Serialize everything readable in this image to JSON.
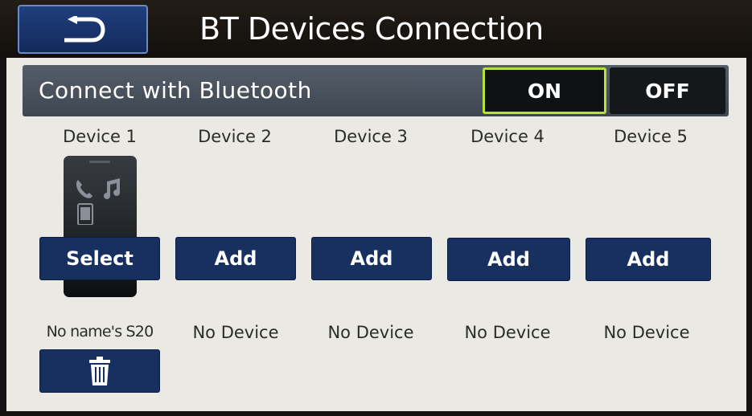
{
  "header": {
    "title": "BT Devices Connection",
    "back_icon": "back-arrow-icon"
  },
  "bluetooth": {
    "label": "Connect with Bluetooth",
    "on_label": "ON",
    "off_label": "OFF",
    "selected": "ON",
    "selected_border_color": "#b6e03a"
  },
  "devices": [
    {
      "title": "Device 1",
      "action": "Select",
      "status": "No name's S20"
    },
    {
      "title": "Device 2",
      "action": "Add",
      "status": "No Device"
    },
    {
      "title": "Device 3",
      "action": "Add",
      "status": "No Device"
    },
    {
      "title": "Device 4",
      "action": "Add",
      "status": "No Device"
    },
    {
      "title": "Device 5",
      "action": "Add",
      "status": "No Device"
    }
  ],
  "device1_icon": "phone-icon",
  "delete_icon": "trash-icon",
  "colors": {
    "button_blue": "#173060",
    "content_bg": "#eae9e4",
    "bar_gray": "#4a525c"
  }
}
